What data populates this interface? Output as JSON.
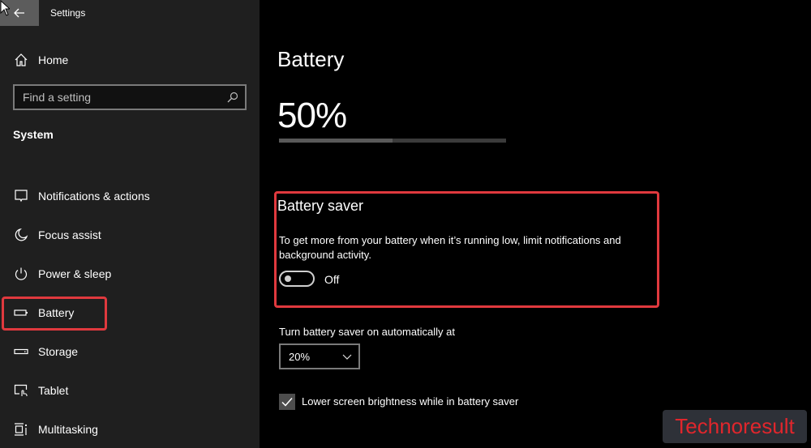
{
  "titlebar": {
    "app_title": "Settings",
    "back_icon": "arrow-left-icon"
  },
  "sidebar": {
    "home_label": "Home",
    "home_icon": "home-icon",
    "search": {
      "placeholder": "Find a setting",
      "value": "",
      "icon": "search-icon"
    },
    "section_label": "System",
    "items": [
      {
        "label": "Notifications & actions",
        "icon": "notification-icon"
      },
      {
        "label": "Focus assist",
        "icon": "moon-icon"
      },
      {
        "label": "Power & sleep",
        "icon": "power-icon"
      },
      {
        "label": "Battery",
        "icon": "battery-icon",
        "selected": true
      },
      {
        "label": "Storage",
        "icon": "storage-icon"
      },
      {
        "label": "Tablet",
        "icon": "tablet-icon"
      },
      {
        "label": "Multitasking",
        "icon": "multitasking-icon"
      }
    ]
  },
  "main": {
    "title": "Battery",
    "battery_percent_text": "50%",
    "battery_level": 0.5,
    "battery_saver": {
      "title": "Battery saver",
      "description": "To get more from your battery when it’s running low, limit notifications and background activity.",
      "toggle_state": "Off",
      "toggle_on": false
    },
    "auto_on": {
      "label": "Turn battery saver on automatically at",
      "selected": "20%"
    },
    "lower_brightness": {
      "label": "Lower screen brightness while in battery saver",
      "checked": true
    }
  },
  "watermark": {
    "text": "Technoresult"
  },
  "colors": {
    "highlight": "#e0393e",
    "watermark_text": "#e0262c"
  }
}
